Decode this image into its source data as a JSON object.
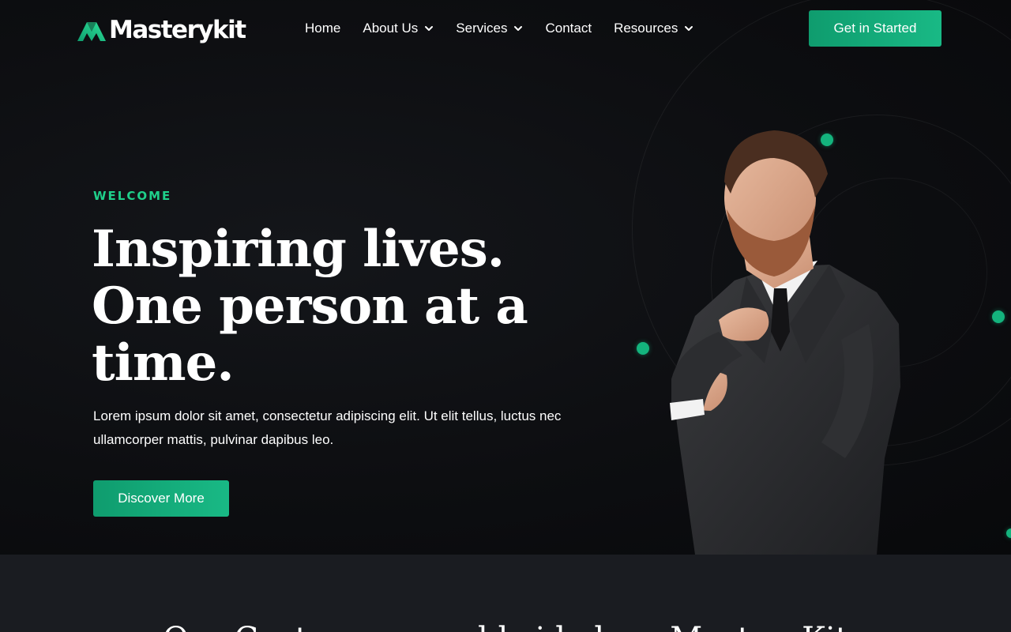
{
  "brand": {
    "name": "Masterykit",
    "accent_color": "#14b37d",
    "logo_icon": "m-chevron-logo-icon"
  },
  "nav": {
    "items": [
      {
        "label": "Home",
        "has_dropdown": false
      },
      {
        "label": "About Us",
        "has_dropdown": true
      },
      {
        "label": "Services",
        "has_dropdown": true
      },
      {
        "label": "Contact",
        "has_dropdown": false
      },
      {
        "label": "Resources",
        "has_dropdown": true
      }
    ],
    "cta_label": "Get in Started"
  },
  "hero": {
    "eyebrow": "WELCOME",
    "headline": "Inspiring lives. One person at a time.",
    "lead": "Lorem ipsum dolor sit amet, consectetur adipiscing elit. Ut elit tellus, luctus nec ullamcorper mattis, pulvinar dapibus leo.",
    "cta_label": "Discover More",
    "image_subject": "man-in-suit-adjusting-tie"
  },
  "section2": {
    "title": "Our Customers worldwide love MasteryKit"
  }
}
